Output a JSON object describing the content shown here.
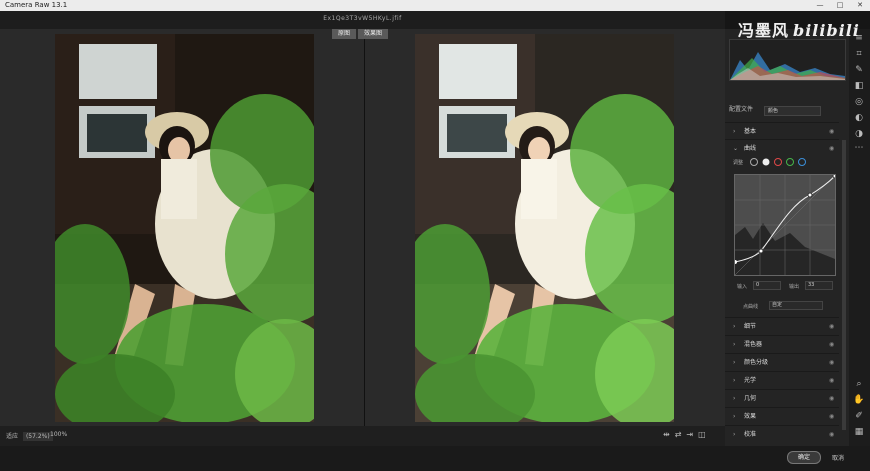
{
  "window": {
    "title": "Camera Raw 13.1",
    "min": "—",
    "max": "□",
    "close": "✕"
  },
  "file": {
    "name": "Ex1Qe3T3vW5HKyL.jfif"
  },
  "view_buttons": [
    "原图",
    "效果图"
  ],
  "bottom": {
    "zoom_label": "适应",
    "zoom_value": "(57.2%)",
    "zoom2": "100%"
  },
  "bottom_icons": [
    "compare-icon",
    "swap-icon",
    "copy-icon",
    "toggle-icon"
  ],
  "panel": {
    "profile_label": "配置文件",
    "profile_value": "颜色",
    "sections_top": [
      {
        "label": "基本"
      },
      {
        "label": "曲线"
      }
    ],
    "curve": {
      "adjust_label": "调整",
      "input_label": "输入",
      "input_value": "0",
      "output_label": "输出",
      "output_value": "33",
      "point_label": "点曲线",
      "point_value": "自定"
    },
    "sections_bottom": [
      {
        "label": "细节"
      },
      {
        "label": "混色器"
      },
      {
        "label": "颜色分级"
      },
      {
        "label": "光学"
      },
      {
        "label": "几何"
      },
      {
        "label": "效果"
      },
      {
        "label": "校准"
      }
    ]
  },
  "watermark": {
    "text": "冯墨风",
    "brand": "bilibili"
  },
  "footer": {
    "ok": "确定",
    "cancel": "取消"
  },
  "colors": {
    "accent": "#3b8fd9",
    "panel": "#242424",
    "leaf": "#4f9e34"
  }
}
